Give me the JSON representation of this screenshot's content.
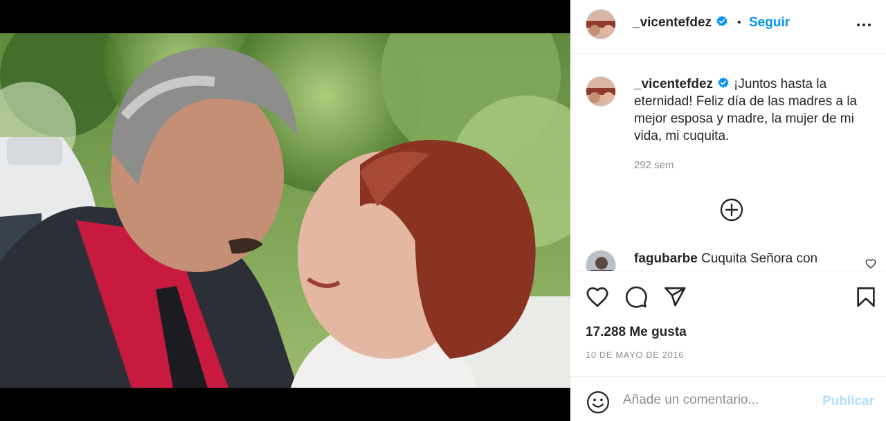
{
  "post": {
    "username": "_vicentefdez",
    "follow_label": "Seguir",
    "separator": "•",
    "caption": "¡Juntos hasta la eternidad! Feliz día de las madres a la mejor esposa y madre, la mujer de mi vida, mi cuquita.",
    "time_ago": "292 sem",
    "likes": "17.288 Me gusta",
    "date": "10 DE MAYO DE 2016"
  },
  "comments": [
    {
      "username": "fagubarbe",
      "text": "Cuquita Señora con"
    }
  ],
  "composer": {
    "placeholder": "Añade un comentario...",
    "publish_label": "Publicar"
  },
  "icons": {
    "verified": "verified-badge-icon",
    "more": "more-options-icon",
    "load_more": "plus-circle-icon",
    "like": "heart-icon",
    "comment": "comment-icon",
    "share": "send-icon",
    "save": "bookmark-icon",
    "emoji": "emoji-icon"
  },
  "colors": {
    "accent": "#0095f6",
    "publish_disabled": "#b2dffc",
    "muted": "#8e8e8e",
    "text": "#262626"
  }
}
